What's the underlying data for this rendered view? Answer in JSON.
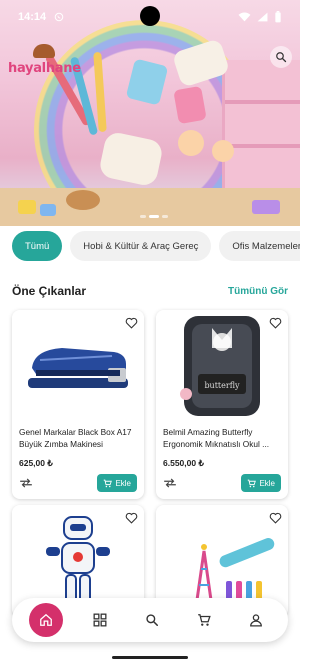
{
  "status_bar": {
    "time": "14:14",
    "icons": [
      "whatsapp-icon",
      "wifi-icon",
      "signal-icon",
      "battery-icon"
    ]
  },
  "header": {
    "logo_text": "hayalhane",
    "search_icon": "search-icon"
  },
  "banner": {
    "page_dots": 3,
    "active_dot": 1
  },
  "categories": [
    {
      "label": "Tümü",
      "active": true
    },
    {
      "label": "Hobi & Kültür & Araç Gereç",
      "active": false
    },
    {
      "label": "Ofis Malzemeleri",
      "active": false
    }
  ],
  "section": {
    "title": "Öne Çıkanlar",
    "see_all": "Tümünü Gör"
  },
  "products": [
    {
      "name": "Genel Markalar Black Box A17 Büyük Zımba Makinesi",
      "price": "625,00 ₺",
      "add_label": "Ekle"
    },
    {
      "name": "Belmil Amazing Butterfly Ergonomik Mıknatıslı Okul ...",
      "price": "6.550,00 ₺",
      "add_label": "Ekle"
    },
    {
      "name": "",
      "price": "",
      "add_label": ""
    },
    {
      "name": "",
      "price": "",
      "add_label": ""
    }
  ],
  "bottom_nav": {
    "items": [
      "home-icon",
      "grid-icon",
      "search-icon",
      "cart-icon",
      "profile-icon"
    ],
    "active": "home-icon"
  },
  "colors": {
    "accent": "#26a69a",
    "brand_pink": "#d4306b"
  }
}
